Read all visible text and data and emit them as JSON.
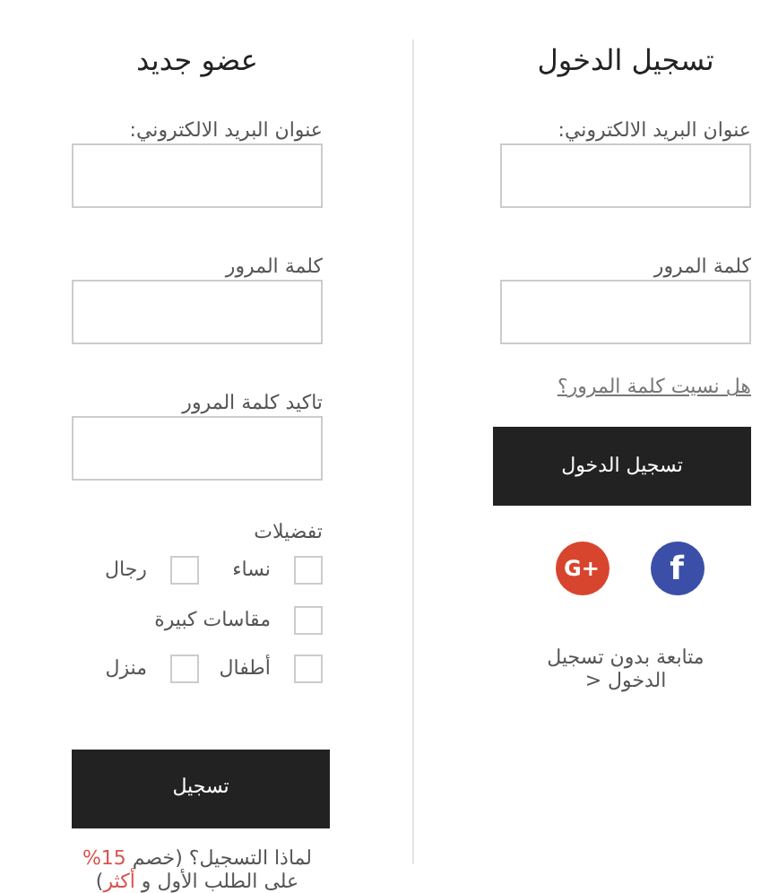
{
  "register": {
    "title": "عضو جديد",
    "fields": [
      {
        "label": "عنوان البريد الالكتروني:"
      },
      {
        "label": "كلمة المرور"
      },
      {
        "label": "تاكيد كلمة المرور"
      }
    ],
    "preferences": {
      "label": "تفضيلات",
      "rows": [
        [
          {
            "label": "نساء",
            "checked": false
          },
          {
            "label": "رجال",
            "checked": false
          }
        ],
        [
          {
            "label": "مقاسات كبيرة",
            "checked": false
          }
        ],
        [
          {
            "label": "أطفال",
            "checked": false
          },
          {
            "label": "منزل",
            "checked": false
          }
        ]
      ]
    },
    "button": "تسجيل",
    "note": [
      {
        "text": "لماذا التسجيل؟ (خصم ",
        "highlight": false
      },
      {
        "text": "15%",
        "highlight": true
      },
      {
        "text": " على الطلب الأول و ",
        "highlight": false
      },
      {
        "text": "أكثر",
        "highlight": true
      },
      {
        "text": ")",
        "highlight": false
      }
    ]
  },
  "login": {
    "title": "تسجيل الدخول",
    "fields": [
      {
        "label": "عنوان البريد الالكتروني:"
      },
      {
        "label": "كلمة المرور"
      }
    ],
    "forgot_link": "هل نسيت كلمة المرور؟",
    "button": "تسجيل الدخول",
    "social": [
      {
        "kind": "facebook",
        "text": "f"
      },
      {
        "kind": "google",
        "text": "G+"
      }
    ],
    "guest_link": "متابعة بدون تسجيل الدخول <"
  }
}
